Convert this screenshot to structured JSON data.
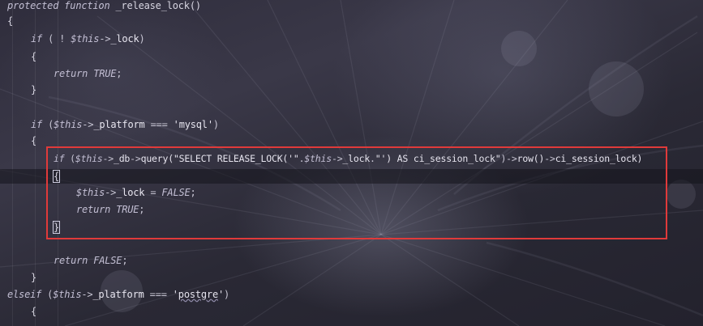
{
  "code": {
    "line1": {
      "kw1": "protected",
      "kw2": "function",
      "name": " _release_lock()"
    },
    "line2": "{",
    "line3": {
      "kw": "if",
      "pre": " ( ! ",
      "var": "$this",
      "arrow": "->",
      "prop": "_lock",
      "post": ")"
    },
    "line4": "{",
    "line5": {
      "kw": "return",
      "cst": "TRUE",
      "post": ";"
    },
    "line6": "}",
    "line7": {
      "kw": "if",
      "pre": " (",
      "var": "$this",
      "arrow": "->",
      "prop": "_platform",
      "op": " === ",
      "str": "'mysql'",
      "post": ")"
    },
    "line8": "{",
    "line9": {
      "kw": "if",
      "pre": " (",
      "var1": "$this",
      "a1": "->",
      "p1": "_db",
      "a2": "->",
      "m1": "query(",
      "s1": "\"SELECT RELEASE_LOCK('\"",
      "dot1": ".",
      "var2": "$this",
      "a3": "->",
      "p2": "_lock",
      "dot2": ".",
      "s2": "\"') AS ci_session_lock\"",
      "close": ")",
      "a4": "->",
      "m2": "row()",
      "a5": "->",
      "p3": "ci_session_lock)"
    },
    "line10": "{",
    "line11": {
      "var": "$this",
      "arrow": "->",
      "prop": "_lock",
      "op": " = ",
      "cst": "FALSE",
      "post": ";"
    },
    "line12": {
      "kw": "return",
      "cst": "TRUE",
      "post": ";"
    },
    "line13": "}",
    "line14": {
      "kw": "return",
      "cst": "FALSE",
      "post": ";"
    },
    "line15": "}",
    "line16": {
      "kw": "elseif",
      "pre": " (",
      "var": "$this",
      "arrow": "->",
      "prop": "_platform",
      "op": " === ",
      "str_open": "'",
      "str_body": "postgre",
      "str_close": "'",
      "post": ")"
    },
    "line17": "{"
  },
  "colors": {
    "highlight_border": "#e03a3a",
    "keyword": "#c3bfd4",
    "text": "#e8e6f0"
  }
}
